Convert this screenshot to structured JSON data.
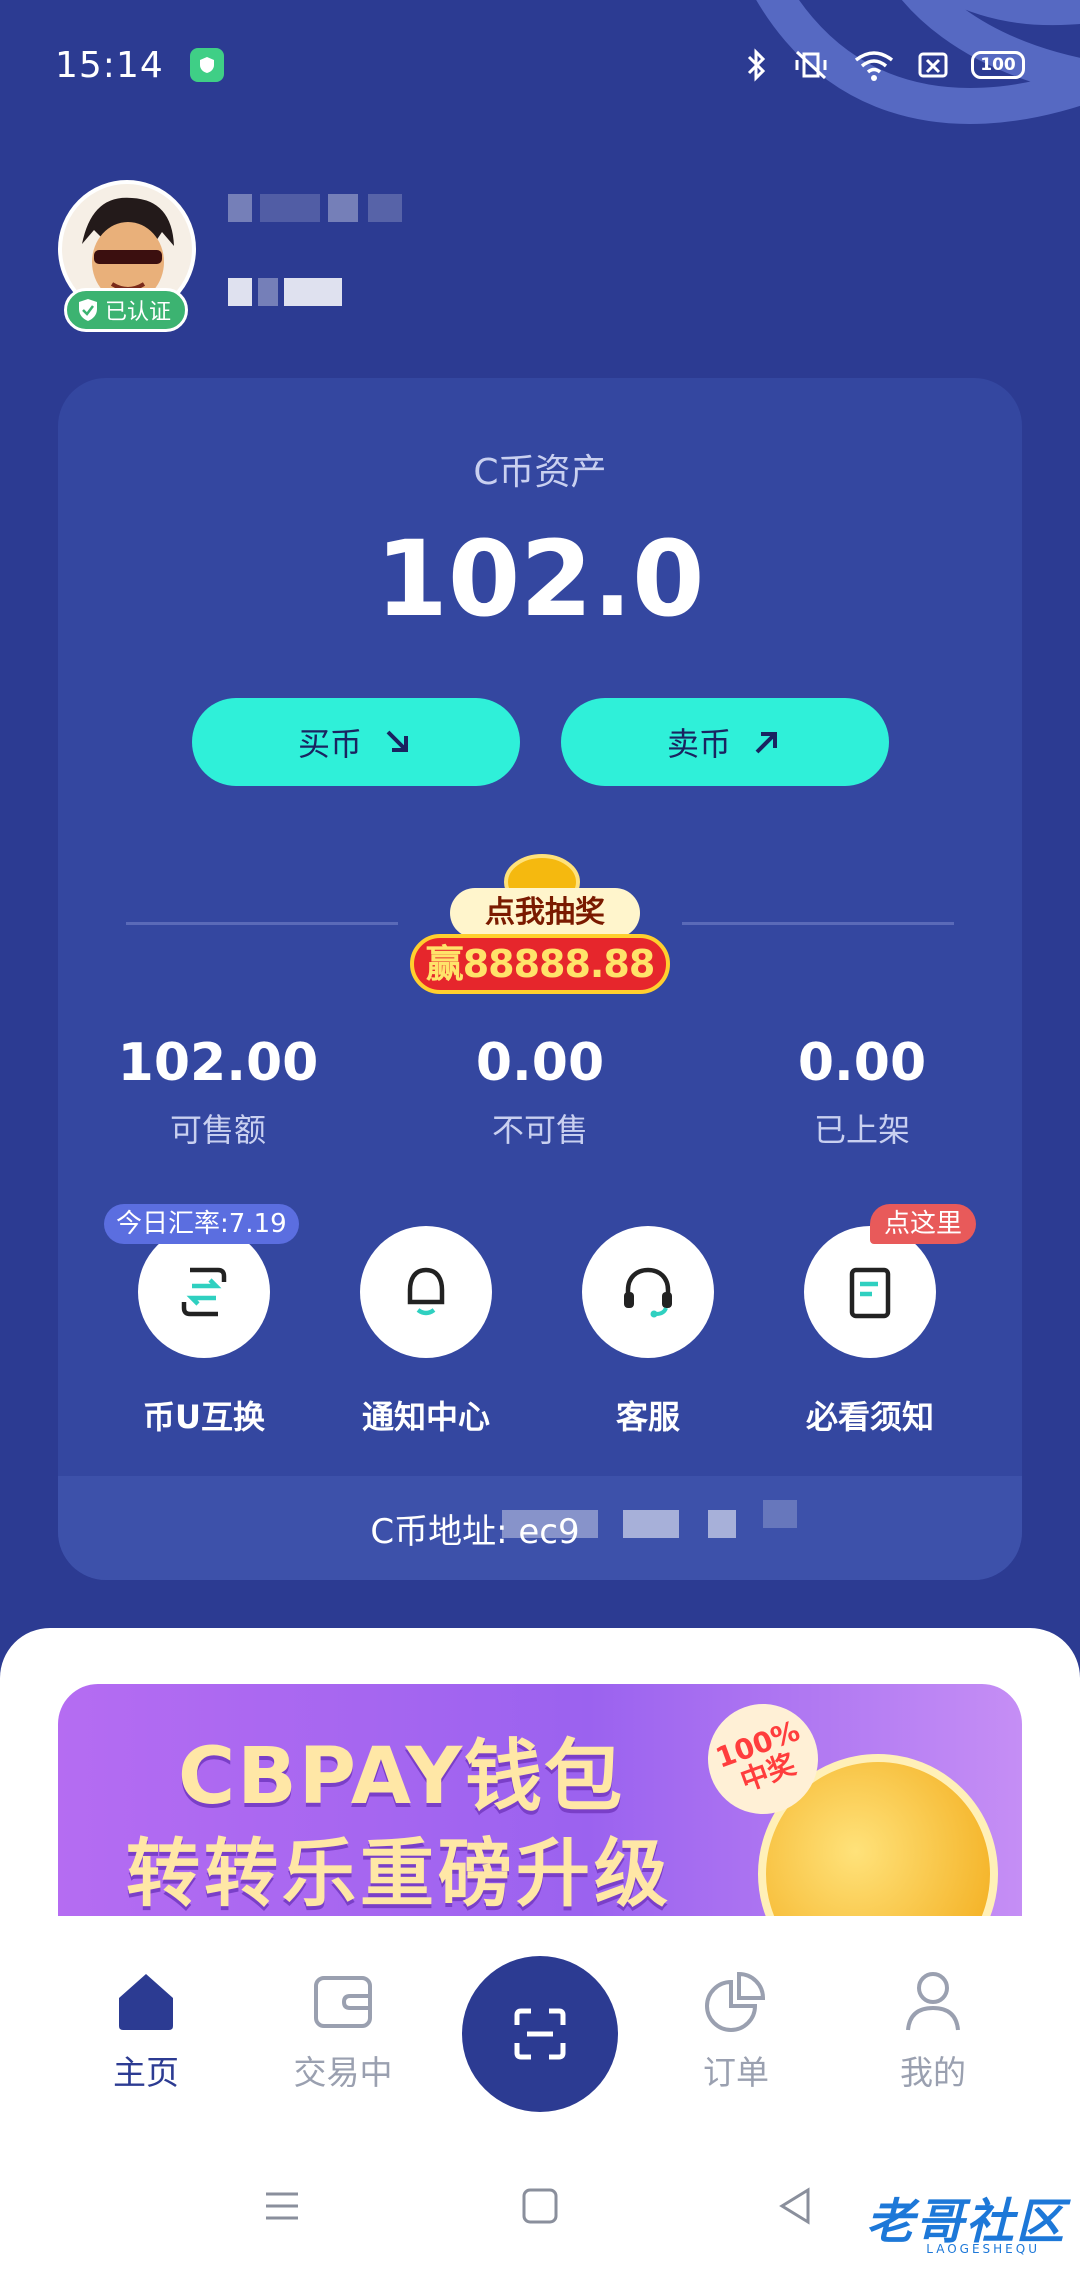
{
  "status_bar": {
    "time": "15:14",
    "battery": "100"
  },
  "profile": {
    "verified_label": "已认证"
  },
  "assets": {
    "label": "C币资产",
    "value": "102.0",
    "buy_label": "买币",
    "sell_label": "卖币"
  },
  "lottery": {
    "title": "点我抽奖",
    "amount": "赢88888.88"
  },
  "stats": [
    {
      "value": "102.00",
      "label": "可售额"
    },
    {
      "value": "0.00",
      "label": "不可售"
    },
    {
      "value": "0.00",
      "label": "已上架"
    }
  ],
  "actions": [
    {
      "label": "币U互换",
      "icon": "exchange-icon"
    },
    {
      "label": "通知中心",
      "icon": "bell-icon"
    },
    {
      "label": "客服",
      "icon": "headset-icon"
    },
    {
      "label": "必看须知",
      "icon": "notebook-icon"
    }
  ],
  "rate_tag": "今日汇率:7.19",
  "click_tag": "点这里",
  "address": {
    "label": "C币地址: ec9"
  },
  "banner": {
    "line1": "CBPAY钱包",
    "line2": "转转乐重磅升级",
    "prize": "100%中奖"
  },
  "tabs": [
    {
      "label": "主页",
      "active": true
    },
    {
      "label": "交易中",
      "active": false
    },
    {
      "label": "订单",
      "active": false
    },
    {
      "label": "我的",
      "active": false
    }
  ],
  "watermark": {
    "text": "老哥社区",
    "sub": "LAOGESHEQU"
  },
  "colors": {
    "primary": "#2c3b92",
    "card": "#3447a0",
    "accent": "#2ff0d9",
    "badge_green": "#3cb371"
  }
}
